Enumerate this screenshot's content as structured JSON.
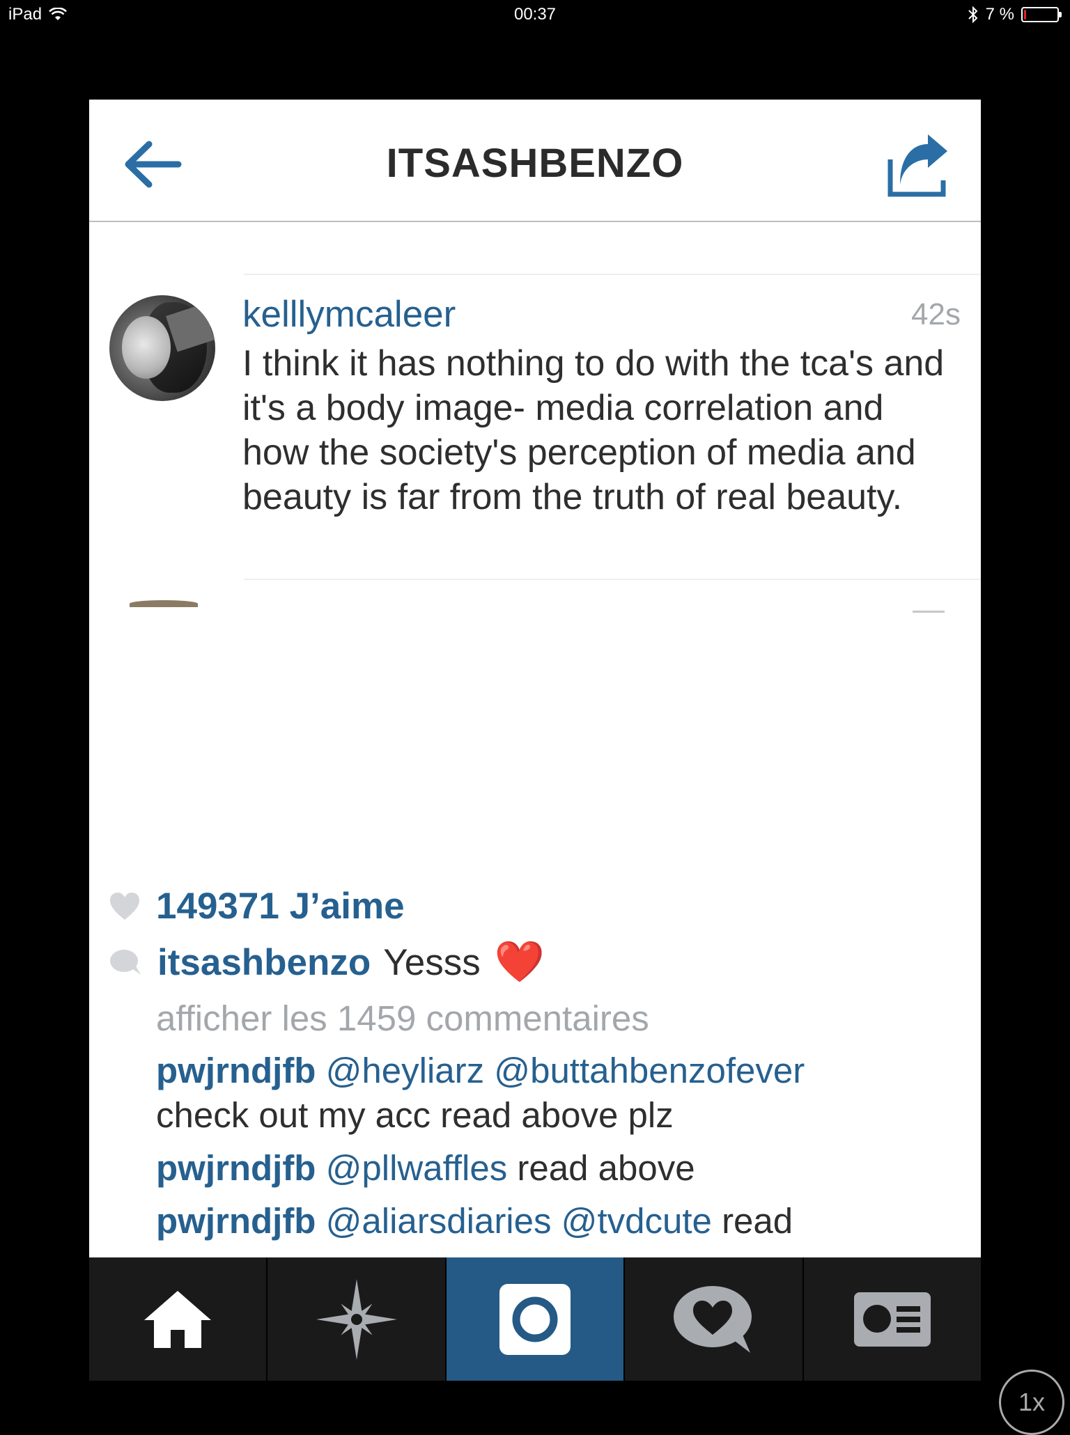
{
  "status_bar": {
    "device": "iPad",
    "time": "00:37",
    "battery_text": "7 %",
    "battery_level": 0.07,
    "battery_color": "#e02020"
  },
  "navbar": {
    "title": "ITSASHBENZO",
    "back_icon": "back-arrow-icon",
    "share_icon": "share-icon",
    "accent_color": "#2a6ea5"
  },
  "comment": {
    "username": "kelllymcaleer",
    "time": "42s",
    "text": "I think it has nothing to do with the tca's and it's a body image- media correlation and how the society's perception of media and beauty is far from the truth of real beauty."
  },
  "post": {
    "likes": "149371 J’aime",
    "caption_user": "itsashbenzo",
    "caption_text": "Yesss",
    "caption_emoji": "❤️",
    "view_all_comments": "afficher les 1459 commentaires",
    "comments": [
      {
        "user": "pwjrndjfb",
        "mentions": "@heyliarz @buttahbenzofever",
        "text": "check out my acc read above plz"
      },
      {
        "user": "pwjrndjfb",
        "mentions": "@pllwaffles",
        "text": "read above"
      },
      {
        "user": "pwjrndjfb",
        "mentions": "@aliarsdiaries @tvdcute",
        "text": "read"
      }
    ]
  },
  "tabbar": {
    "tabs": [
      {
        "name": "home",
        "icon": "home-icon",
        "active": false
      },
      {
        "name": "explore",
        "icon": "explore-star-icon",
        "active": false
      },
      {
        "name": "camera",
        "icon": "camera-icon",
        "active": true
      },
      {
        "name": "activity",
        "icon": "heart-bubble-icon",
        "active": false
      },
      {
        "name": "profile",
        "icon": "profile-card-icon",
        "active": false
      }
    ],
    "active_color": "#245a85"
  },
  "zoom_indicator": "1x"
}
